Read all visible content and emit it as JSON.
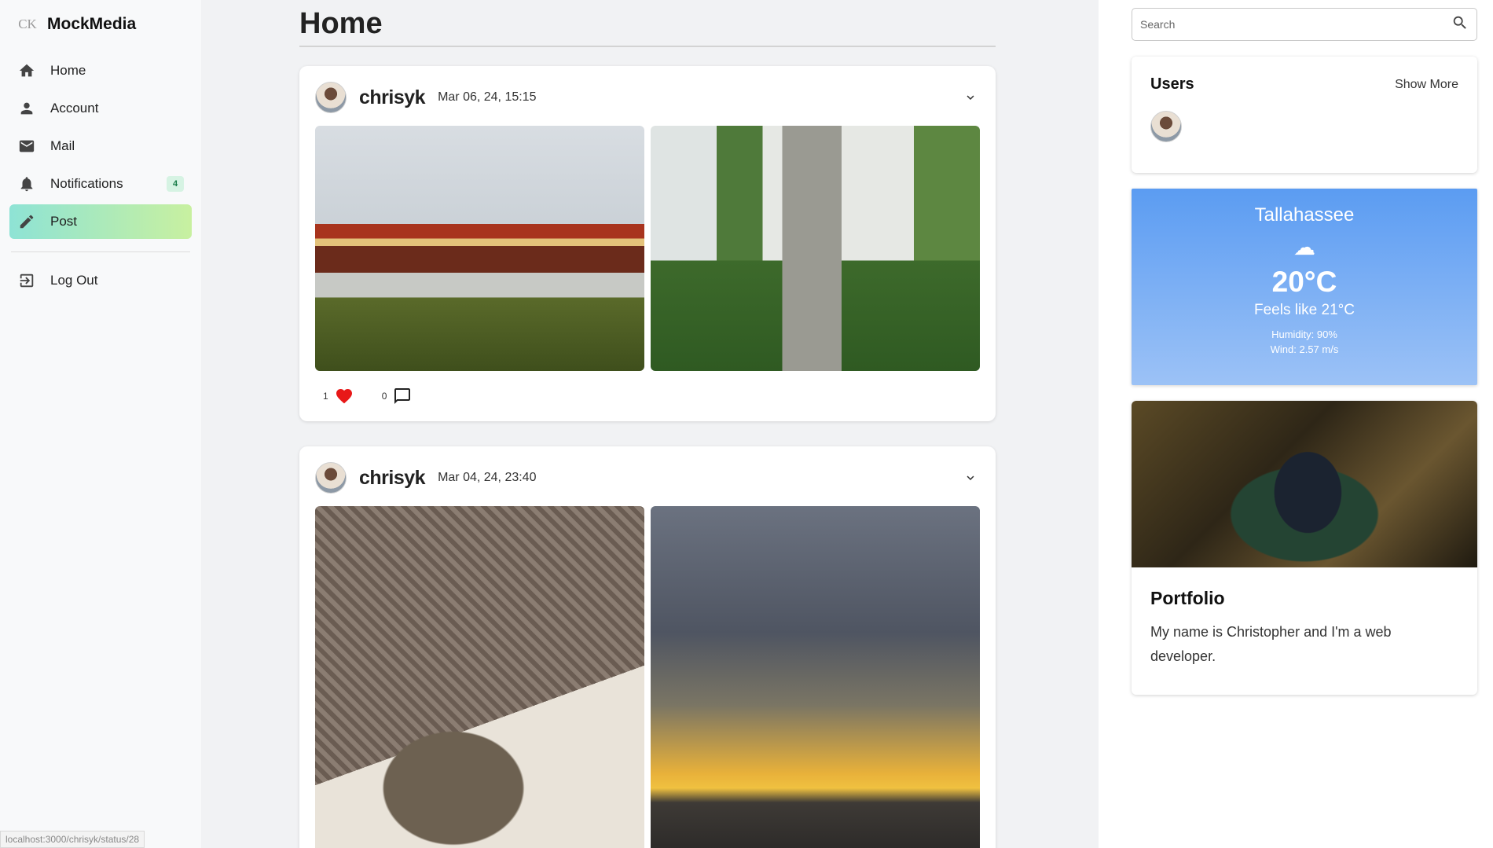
{
  "brand": {
    "logo": "CK",
    "name": "MockMedia"
  },
  "nav": {
    "items": [
      {
        "label": "Home",
        "icon": "home-icon"
      },
      {
        "label": "Account",
        "icon": "person-icon"
      },
      {
        "label": "Mail",
        "icon": "mail-icon"
      },
      {
        "label": "Notifications",
        "icon": "bell-icon",
        "badge": "4"
      },
      {
        "label": "Post",
        "icon": "pencil-icon",
        "active": true
      }
    ],
    "logout": {
      "label": "Log Out",
      "icon": "logout-icon"
    }
  },
  "feed": {
    "title": "Home",
    "posts": [
      {
        "user": "chrisyk",
        "date": "Mar 06, 24, 15:15",
        "likes": "1",
        "comments": "0"
      },
      {
        "user": "chrisyk",
        "date": "Mar 04, 24, 23:40"
      }
    ]
  },
  "search": {
    "placeholder": "Search"
  },
  "users": {
    "title": "Users",
    "show_more": "Show More"
  },
  "weather": {
    "city": "Tallahassee",
    "icon": "☁",
    "temp": "20°C",
    "feels": "Feels like 21°C",
    "humidity": "Humidity: 90%",
    "wind": "Wind: 2.57 m/s"
  },
  "portfolio": {
    "title": "Portfolio",
    "text": "My name is Christopher and I'm a web developer."
  },
  "status_bar": {
    "url": "localhost:3000/chrisyk/status/28"
  },
  "colors": {
    "active_gradient_start": "#8ee3d5",
    "active_gradient_end": "#c8f0a0",
    "like": "#e81818",
    "weather_top": "#5b9cf2"
  }
}
